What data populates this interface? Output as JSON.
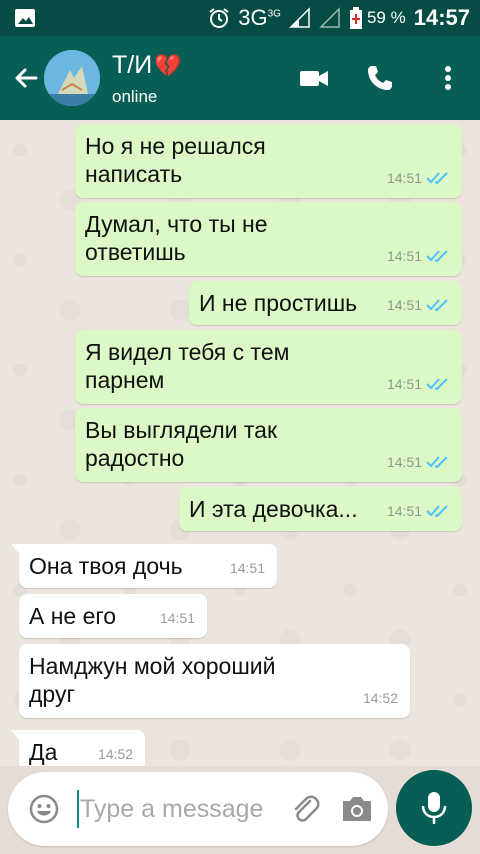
{
  "status_bar": {
    "network": "3G",
    "network_sup": "3G",
    "battery": "59 %",
    "time": "14:57"
  },
  "header": {
    "contact_name": "Т/И",
    "contact_emoji": "💔",
    "contact_status": "online"
  },
  "messages": [
    {
      "dir": "out",
      "text": "Но я не решался написать",
      "time": "14:51",
      "status": "read"
    },
    {
      "dir": "out",
      "text": "Думал, что ты не ответишь",
      "time": "14:51",
      "status": "read"
    },
    {
      "dir": "out",
      "text": "И не простишь",
      "time": "14:51",
      "status": "read"
    },
    {
      "dir": "out",
      "text": "Я видел тебя с тем парнем",
      "time": "14:51",
      "status": "read"
    },
    {
      "dir": "out",
      "text": "Вы выглядели так радостно",
      "time": "14:51",
      "status": "read"
    },
    {
      "dir": "out",
      "text": "И эта девочка...",
      "time": "14:51",
      "status": "read"
    },
    {
      "dir": "in",
      "text": "Она твоя дочь",
      "time": "14:51"
    },
    {
      "dir": "in",
      "text": "А не его",
      "time": "14:51"
    },
    {
      "dir": "in",
      "text": "Намджун мой хороший друг",
      "time": "14:52"
    },
    {
      "dir": "in",
      "text": "Да",
      "time": "14:52"
    }
  ],
  "composer": {
    "placeholder": "Type a message",
    "value": ""
  },
  "icons": {
    "back": "arrow-left-icon",
    "video": "video-call-icon",
    "call": "phone-icon",
    "menu": "more-vert-icon",
    "emoji": "emoji-icon",
    "attach": "paperclip-icon",
    "camera": "camera-icon",
    "mic": "microphone-icon"
  },
  "colors": {
    "header": "#075e54",
    "status_bar": "#054d44",
    "outgoing_bubble": "#dcf8c6",
    "incoming_bubble": "#ffffff",
    "read_ticks": "#4fc3f7"
  }
}
